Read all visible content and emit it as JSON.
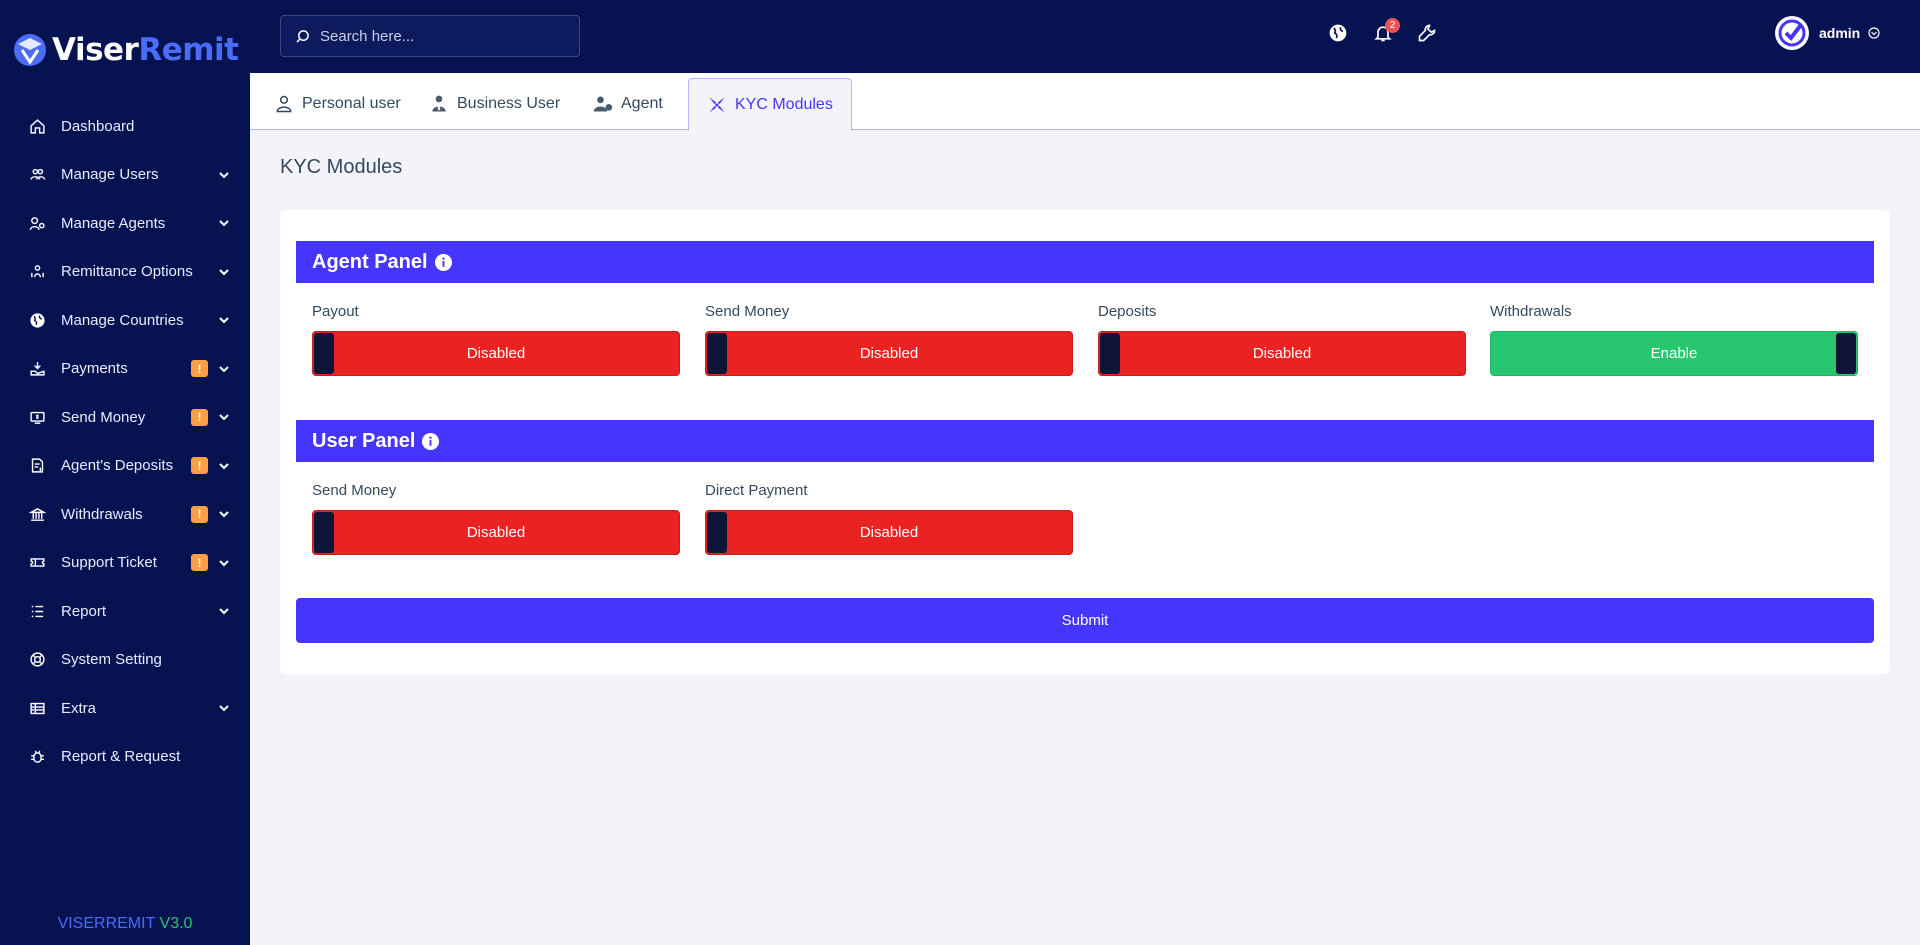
{
  "brand": {
    "part1": "Viser",
    "part2": "Remit"
  },
  "version": {
    "name": "VISERREMIT",
    "number": "V3.0"
  },
  "sidebar": {
    "items": [
      {
        "label": "Dashboard",
        "icon": "home-icon",
        "chevron": false,
        "badge": ""
      },
      {
        "label": "Manage Users",
        "icon": "users-icon",
        "chevron": true,
        "badge": ""
      },
      {
        "label": "Manage Agents",
        "icon": "agents-icon",
        "chevron": true,
        "badge": ""
      },
      {
        "label": "Remittance Options",
        "icon": "remittance-icon",
        "chevron": true,
        "badge": ""
      },
      {
        "label": "Manage Countries",
        "icon": "globe-icon",
        "chevron": true,
        "badge": ""
      },
      {
        "label": "Payments",
        "icon": "payment-icon",
        "chevron": true,
        "badge": "!"
      },
      {
        "label": "Send Money",
        "icon": "money-icon",
        "chevron": true,
        "badge": "!"
      },
      {
        "label": "Agent's Deposits",
        "icon": "deposit-icon",
        "chevron": true,
        "badge": "!"
      },
      {
        "label": "Withdrawals",
        "icon": "bank-icon",
        "chevron": true,
        "badge": "!"
      },
      {
        "label": "Support Ticket",
        "icon": "ticket-icon",
        "chevron": true,
        "badge": "!"
      },
      {
        "label": "Report",
        "icon": "list-icon",
        "chevron": true,
        "badge": ""
      },
      {
        "label": "System Setting",
        "icon": "lifebuoy-icon",
        "chevron": false,
        "badge": ""
      },
      {
        "label": "Extra",
        "icon": "extra-icon",
        "chevron": true,
        "badge": ""
      },
      {
        "label": "Report & Request",
        "icon": "bug-icon",
        "chevron": false,
        "badge": ""
      }
    ]
  },
  "topbar": {
    "search_placeholder": "Search here...",
    "notification_count": "2",
    "username": "admin"
  },
  "tabs": [
    {
      "label": "Personal user",
      "active": false
    },
    {
      "label": "Business User",
      "active": false
    },
    {
      "label": "Agent",
      "active": false
    },
    {
      "label": "KYC Modules",
      "active": true
    }
  ],
  "page_title": "KYC Modules",
  "agent_panel": {
    "title": "Agent Panel",
    "fields": [
      {
        "label": "Payout",
        "state": "Disabled",
        "enabled": false
      },
      {
        "label": "Send Money",
        "state": "Disabled",
        "enabled": false
      },
      {
        "label": "Deposits",
        "state": "Disabled",
        "enabled": false
      },
      {
        "label": "Withdrawals",
        "state": "Enable",
        "enabled": true
      }
    ]
  },
  "user_panel": {
    "title": "User Panel",
    "fields": [
      {
        "label": "Send Money",
        "state": "Disabled",
        "enabled": false
      },
      {
        "label": "Direct Payment",
        "state": "Disabled",
        "enabled": false
      }
    ]
  },
  "submit_label": "Submit",
  "colors": {
    "primary": "#4634ff",
    "sidebar": "#071251",
    "disabled": "#ea2222",
    "enabled": "#28c76f",
    "warning": "#ff9f43"
  }
}
